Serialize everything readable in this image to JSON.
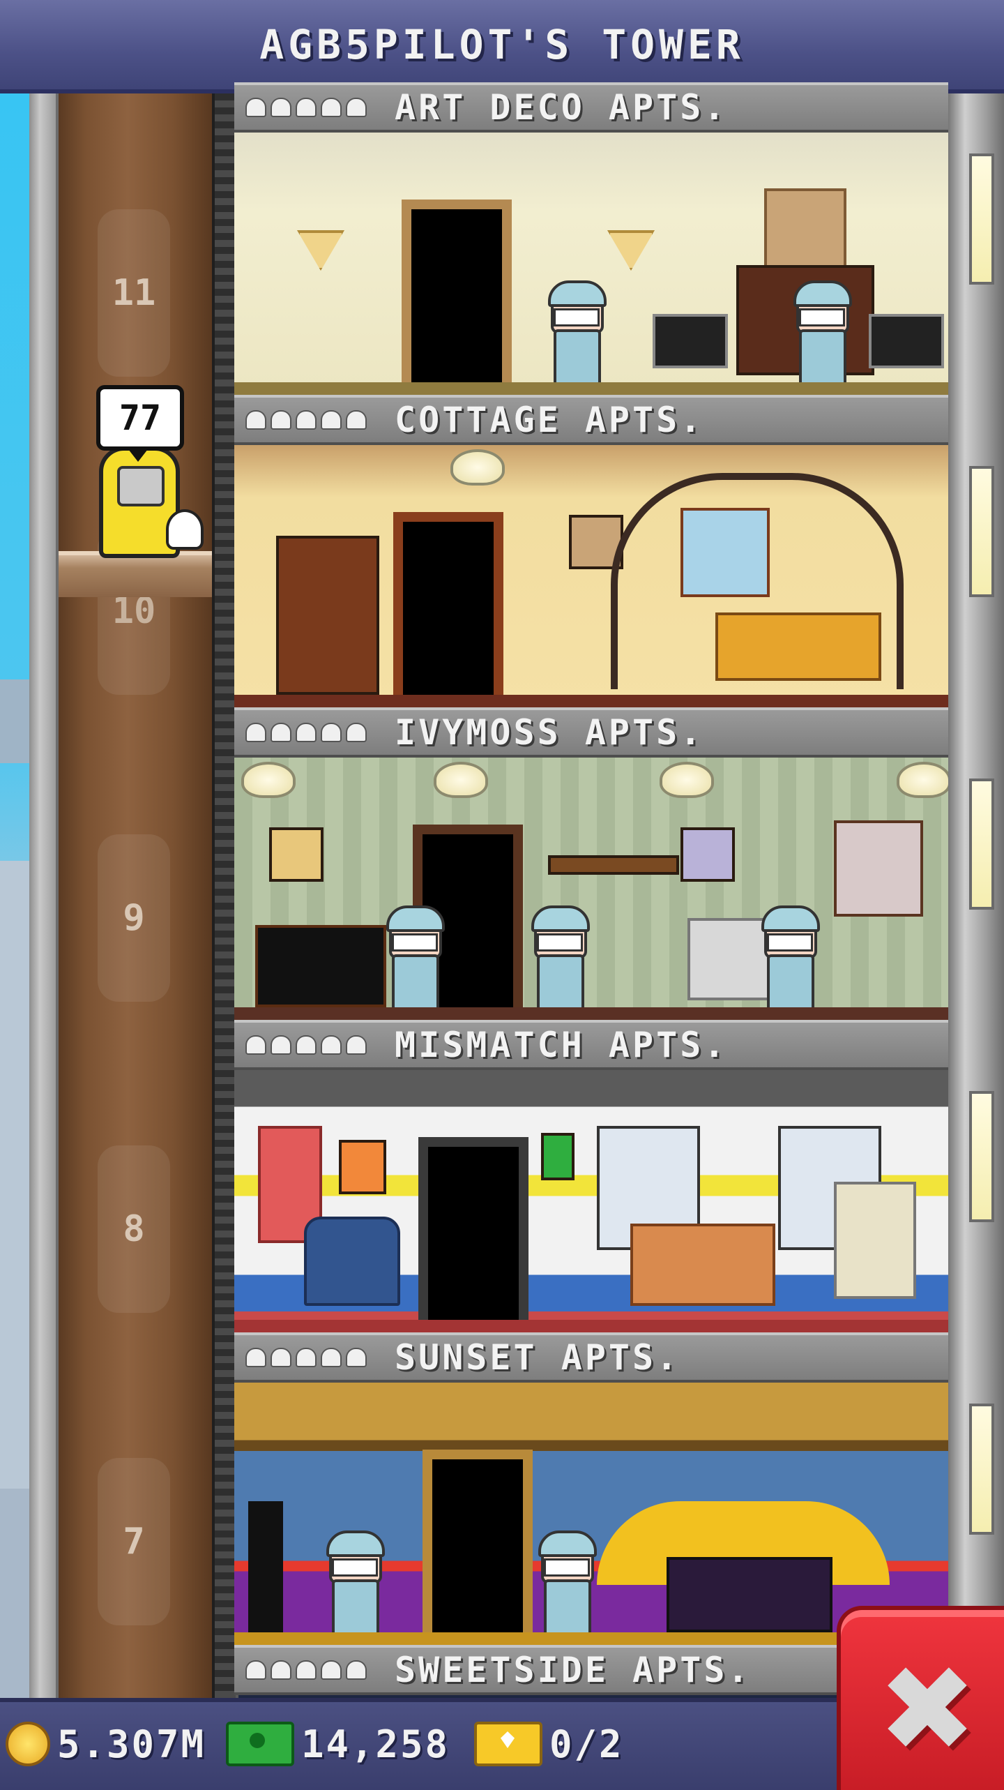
{
  "header": {
    "title": "AGB5PILOT'S TOWER"
  },
  "elevator": {
    "destination": "77",
    "floor_numbers": [
      "11",
      "10",
      "9",
      "8",
      "7"
    ]
  },
  "floors": [
    {
      "name": "ART DECO APTS."
    },
    {
      "name": "COTTAGE APTS."
    },
    {
      "name": "IVYMOSS APTS."
    },
    {
      "name": "MISMATCH APTS."
    },
    {
      "name": "SUNSET APTS."
    },
    {
      "name": "SWEETSIDE APTS."
    }
  ],
  "resources": {
    "coins": "5.307M",
    "bux": "14,258",
    "tickets": "0/2"
  },
  "icons": {
    "coin": "coin-icon",
    "bux": "bux-icon",
    "ticket": "ticket-icon",
    "close": "close-icon"
  },
  "close_button": {
    "label": "✖"
  }
}
